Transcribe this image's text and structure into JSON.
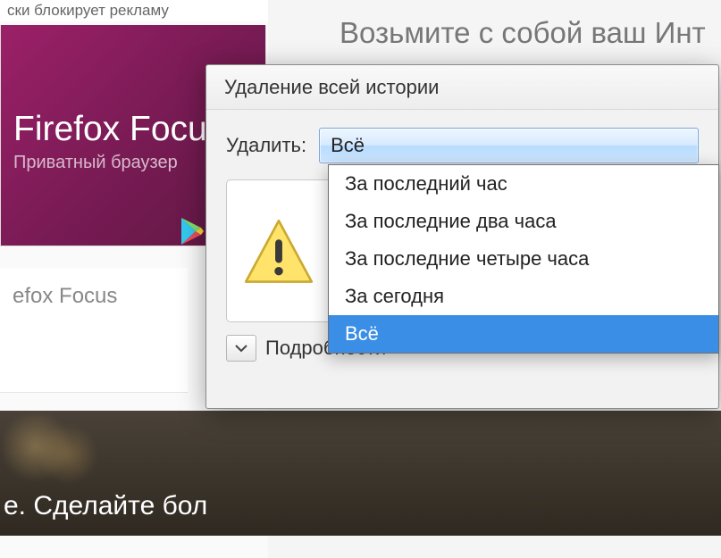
{
  "background": {
    "ad_block_note": "ски блокирует рекламу",
    "promo_title": "Firefox Focus",
    "promo_sub": "Приватный браузер",
    "promo_caption": "efox Focus",
    "headline": "Возьмите с собой ваш Инт",
    "dark_text": "е. Сделайте бол"
  },
  "dialog": {
    "title": "Удаление всей истории",
    "field_label": "Удалить:",
    "select_value": "Всё",
    "details_label": "Подробности",
    "options": {
      "0": "За последний час",
      "1": "За последние два часа",
      "2": "За последние четыре часа",
      "3": "За сегодня",
      "4": "Всё"
    }
  }
}
